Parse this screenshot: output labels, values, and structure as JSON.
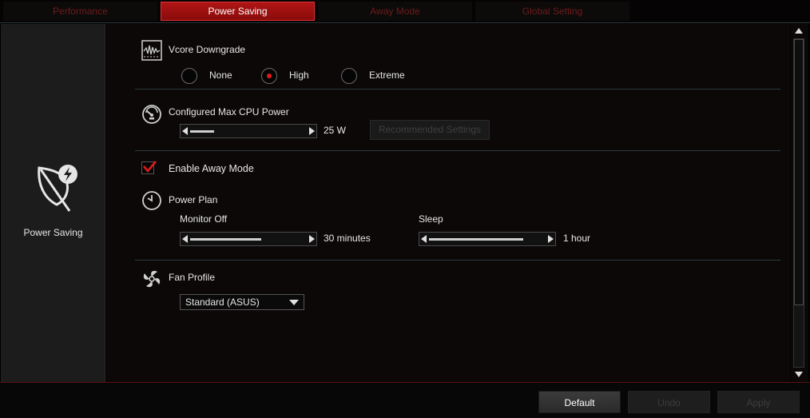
{
  "tabs": [
    {
      "label": "Performance",
      "active": false
    },
    {
      "label": "Power Saving",
      "active": true
    },
    {
      "label": "Away Mode",
      "active": false
    },
    {
      "label": "Global Setting",
      "active": false
    }
  ],
  "sidebar": {
    "icon": "leaf-lightning-icon",
    "label": "Power Saving"
  },
  "vcore": {
    "title": "Vcore Downgrade",
    "icon": "waveform-chip-icon",
    "options": [
      "None",
      "High",
      "Extreme"
    ],
    "selected": "High"
  },
  "cpu_power": {
    "title": "Configured Max CPU Power",
    "icon": "gauge-icon",
    "value": "25 W",
    "level": 0.2,
    "button_label": "Recommended Settings",
    "button_enabled": false
  },
  "away_mode": {
    "label": "Enable Away Mode",
    "checked": true
  },
  "power_plan": {
    "title": "Power Plan",
    "icon": "clock-icon",
    "monitor_off": {
      "label": "Monitor Off",
      "value": "30 minutes",
      "level": 0.6
    },
    "sleep": {
      "label": "Sleep",
      "value": "1 hour",
      "level": 0.8
    }
  },
  "fan_profile": {
    "title": "Fan Profile",
    "icon": "fan-icon",
    "selected": "Standard (ASUS)"
  },
  "footer": {
    "default_label": "Default",
    "undo_label": "Undo",
    "apply_label": "Apply"
  },
  "colors": {
    "accent": "#b01515",
    "check": "#e01a1a",
    "background": "#0c0808"
  }
}
